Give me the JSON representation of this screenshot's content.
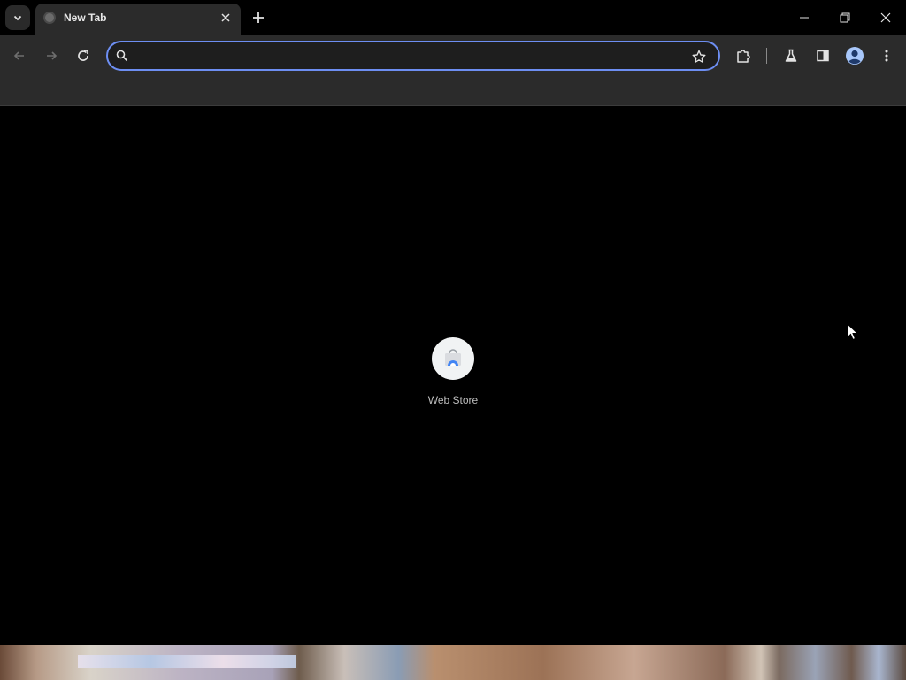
{
  "tabs": [
    {
      "title": "New Tab",
      "active": true
    }
  ],
  "omnibox": {
    "value": "",
    "placeholder": ""
  },
  "content": {
    "shortcuts": [
      {
        "label": "Web Store",
        "icon": "web-store-icon"
      }
    ]
  },
  "icons": {
    "tab_search": "chevron-down-icon",
    "tab_close": "close-icon",
    "new_tab": "plus-icon",
    "minimize": "minimize-icon",
    "restore": "restore-icon",
    "close_window": "close-icon",
    "back": "arrow-left-icon",
    "forward": "arrow-right-icon",
    "reload": "reload-icon",
    "search": "search-icon",
    "bookmark": "star-icon",
    "extensions": "puzzle-icon",
    "labs": "flask-icon",
    "side_panel": "side-panel-icon",
    "profile": "profile-icon",
    "menu": "kebab-menu-icon"
  },
  "colors": {
    "frame": "#000000",
    "toolbar": "#2b2b2b",
    "omnibox_focus_ring": "#6d8ef2",
    "profile_accent": "#a8c7fa"
  }
}
